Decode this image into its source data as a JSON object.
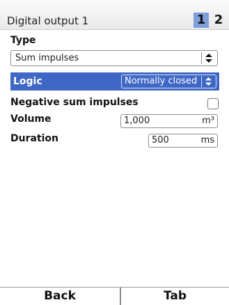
{
  "header": {
    "title": "Digital output 1",
    "tabs": [
      "1",
      "2"
    ],
    "active_tab": "1",
    "active_tab_color": "#7f9fd9"
  },
  "form": {
    "type_label": "Type",
    "type_value": "Sum impulses",
    "logic_label": "Logic",
    "logic_value": "Normally closed",
    "selected_row_color": "#3f68c6",
    "negative_label": "Negative sum impulses",
    "negative_checked": false,
    "volume_label": "Volume",
    "volume_value": "1,000",
    "volume_unit": "m³",
    "duration_label": "Duration",
    "duration_value": "500",
    "duration_unit": "ms"
  },
  "softkeys": {
    "left": "Back",
    "right": "Tab"
  },
  "icons": {
    "select_arrows": "up-down-arrows-icon"
  }
}
